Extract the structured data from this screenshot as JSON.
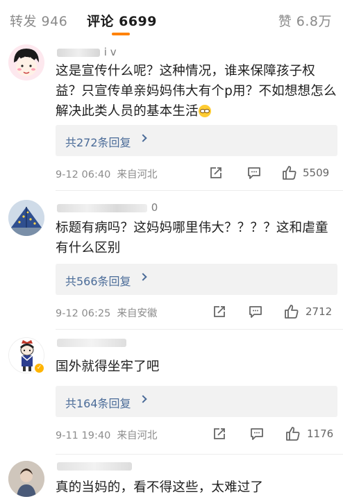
{
  "tabs": {
    "repost": "转发 946",
    "comment": "评论 6699",
    "like": "赞 6.8万",
    "accent_color": "#ff8200"
  },
  "comments": [
    {
      "username_visible": "i v",
      "text": "这是宣传什么呢？这种情况，谁来保障孩子权益？只宣传单亲妈妈伟大有个p用？不如想想怎么解决此类人员的基本生活",
      "emoji": "glasses-emoji",
      "replies": "共272条回复",
      "time": "9-12 06:40",
      "source": "来自河北",
      "likes": "5509"
    },
    {
      "username_visible": "0",
      "text": "标题有病吗？这妈妈哪里伟大？？？？这和虐童有什么区别",
      "replies": "共566条回复",
      "time": "9-12 06:25",
      "source": "来自安徽",
      "likes": "2712"
    },
    {
      "username_visible": "",
      "text": "国外就得坐牢了吧",
      "replies": "共164条回复",
      "time": "9-11 19:40",
      "source": "来自河北",
      "likes": "1176"
    },
    {
      "username_visible": "",
      "text": "真的当妈的，看不得这些，太难过了"
    }
  ],
  "icons": {
    "share": "share-icon",
    "comment": "comment-icon",
    "like": "thumbs-up-icon",
    "chevron": "chevron-right-icon",
    "verified": "verified-badge-icon"
  },
  "colors": {
    "link": "#4a6b98",
    "reply_bg": "#f2f2f2",
    "meta_text": "#8c8c8c",
    "verified_badge": "#ffb400"
  }
}
